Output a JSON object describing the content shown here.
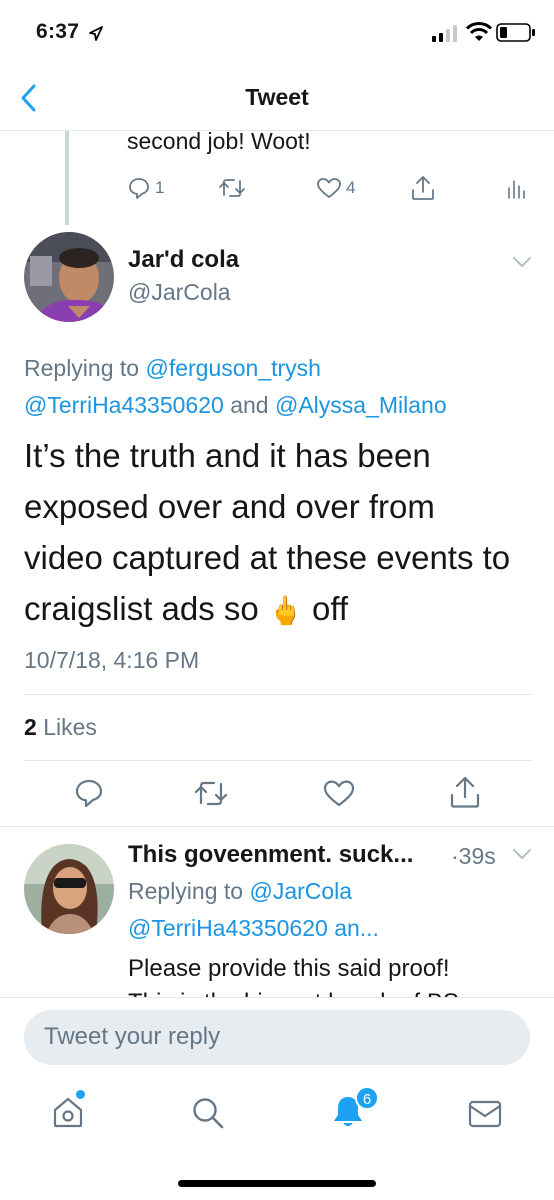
{
  "status": {
    "time": "6:37"
  },
  "nav": {
    "title": "Tweet"
  },
  "previous_tweet": {
    "text": "second job! Woot!",
    "reply_count": "1",
    "like_count": "4"
  },
  "main_tweet": {
    "name": "Jar'd cola",
    "handle": "@JarCola",
    "replying_prefix": "Replying to",
    "reply_user_1": "@ferguson_trysh",
    "reply_user_2": "@TerriHa43350620",
    "reply_and": "and",
    "reply_user_3": "@Alyssa_Milano",
    "text_line_1": "It’s the truth and it has been",
    "text_line_2": "exposed over and over from",
    "text_line_3": "video captured at these events to",
    "text_line_4_a": "craigslist ads so",
    "emoji": "🖕",
    "text_line_4_b": "off",
    "timestamp": "10/7/18, 4:16 PM",
    "likes_count": "2",
    "likes_label": "Likes"
  },
  "reply_tweet": {
    "name": "This goveenment. suck...",
    "age": "·39s",
    "replying_prefix": "Replying to",
    "reply_user": "@JarCola",
    "reply_more": "@TerriHa43350620 an...",
    "text_line_1": "Please provide this said proof!",
    "text_line_2": "This is the biggest bunch of BS"
  },
  "composer": {
    "placeholder": "Tweet your reply"
  },
  "tabbar": {
    "notifications_badge": "6"
  },
  "colors": {
    "accent": "#1da1f2",
    "link": "#1b95e0",
    "muted": "#657786"
  }
}
